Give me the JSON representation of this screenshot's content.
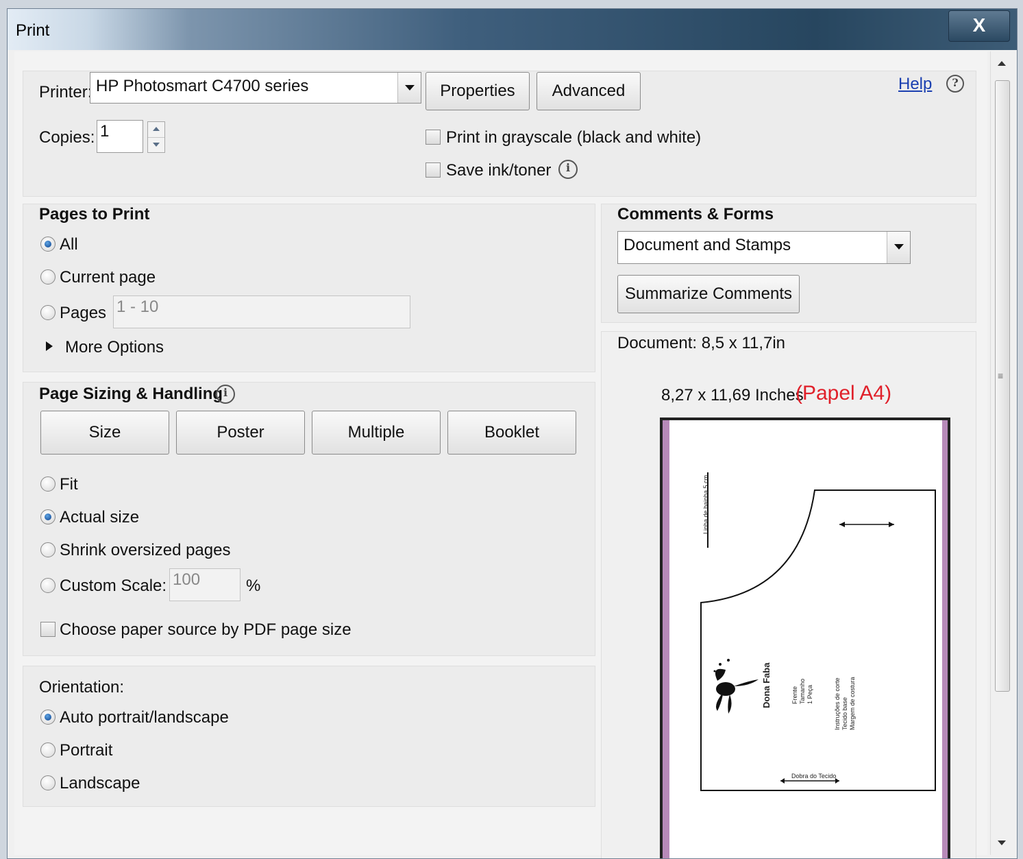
{
  "window": {
    "title": "Print",
    "close_label": "X"
  },
  "printer": {
    "label": "Printer:",
    "selected": "HP Photosmart C4700 series",
    "properties_label": "Properties",
    "advanced_label": "Advanced",
    "help_label": "Help",
    "help_icon": "?"
  },
  "copies": {
    "label": "Copies:",
    "value": "1"
  },
  "options": {
    "grayscale_label": "Print in grayscale (black and white)",
    "save_ink_label": "Save ink/toner",
    "info_icon": "i"
  },
  "pages_to_print": {
    "title": "Pages to Print",
    "all_label": "All",
    "current_label": "Current page",
    "pages_label": "Pages",
    "pages_value": "1 - 10",
    "more_label": "More Options",
    "selected": "all"
  },
  "sizing": {
    "title": "Page Sizing & Handling",
    "tabs": [
      "Size",
      "Poster",
      "Multiple",
      "Booklet"
    ],
    "fit_label": "Fit",
    "actual_label": "Actual size",
    "shrink_label": "Shrink oversized pages",
    "custom_label": "Custom Scale:",
    "custom_value": "100",
    "percent": "%",
    "paper_source_label": "Choose paper source by PDF page size",
    "selected": "actual"
  },
  "orientation": {
    "title": "Orientation:",
    "auto_label": "Auto portrait/landscape",
    "portrait_label": "Portrait",
    "landscape_label": "Landscape",
    "selected": "auto"
  },
  "comments": {
    "title": "Comments & Forms",
    "selected": "Document and Stamps",
    "summarize_label": "Summarize Comments"
  },
  "preview": {
    "document_size": "Document: 8,5 x 11,7in",
    "paper_size": "8,27 x 11,69 Inches",
    "paper_note": "(Papel A4)",
    "note_color": "#e0202a"
  }
}
